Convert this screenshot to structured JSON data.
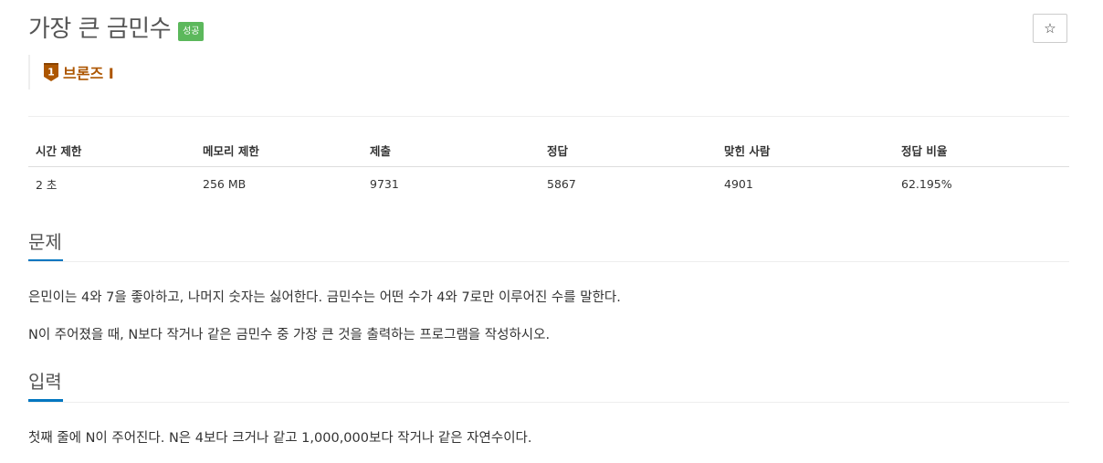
{
  "problem": {
    "title": "가장 큰 금민수",
    "result_badge": "성공",
    "star_icon": "star-outline-icon",
    "tier": {
      "label": "브론즈 I",
      "icon": "bronze-tier-1-icon",
      "icon_digit": "1",
      "color": "#ad5600"
    }
  },
  "info_table": {
    "headers": [
      "시간 제한",
      "메모리 제한",
      "제출",
      "정답",
      "맞힌 사람",
      "정답 비율"
    ],
    "values": [
      "2 초",
      "256 MB",
      "9731",
      "5867",
      "4901",
      "62.195%"
    ]
  },
  "sections": {
    "description": {
      "heading": "문제",
      "paragraphs": [
        "은민이는 4와 7을 좋아하고, 나머지 숫자는 싫어한다. 금민수는 어떤 수가 4와 7로만 이루어진 수를 말한다.",
        "N이 주어졌을 때, N보다 작거나 같은 금민수 중 가장 큰 것을 출력하는 프로그램을 작성하시오."
      ]
    },
    "input": {
      "heading": "입력",
      "paragraphs": [
        "첫째 줄에 N이 주어진다. N은 4보다 크거나 같고 1,000,000보다 작거나 같은 자연수이다."
      ]
    }
  },
  "colors": {
    "success_badge": "#5cb85c",
    "tier_bronze": "#ad5600",
    "heading_underline": "#0076c0"
  }
}
